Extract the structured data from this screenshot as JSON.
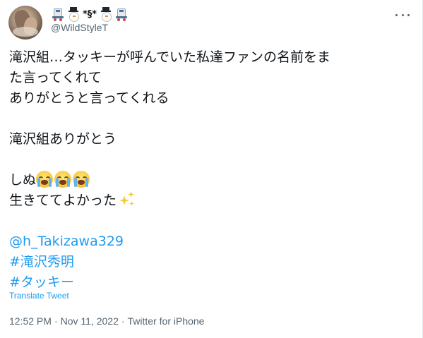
{
  "author": {
    "display_name": "*§*",
    "handle": "@WildStyleT"
  },
  "tweet": {
    "lines": [
      "滝沢組…タッキーが呼んでいた私達ファンの名前をま",
      "た言ってくれて",
      "ありがとうと言ってくれる",
      "滝沢組ありがとう",
      "しぬ",
      "生きててよかった"
    ],
    "mention": "@h_Takizawa329",
    "hashtags": [
      "#滝沢秀明",
      "#タッキー"
    ]
  },
  "actions": {
    "translate_label": "Translate Tweet"
  },
  "meta": {
    "time": "12:52 PM",
    "separator": "·",
    "date": "Nov 11, 2022",
    "source": "Twitter for iPhone"
  },
  "icons": {
    "name_decoration": [
      "roller-skate-icon",
      "snowman-icon",
      "snowman-icon",
      "roller-skate-icon"
    ],
    "crying_emoji": "loudly-crying-face-icon",
    "sparkles_emoji": "sparkles-icon",
    "more": "more-options-icon"
  },
  "colors": {
    "link": "#1d9bf0",
    "secondary_text": "#536471",
    "primary_text": "#0f1419"
  }
}
